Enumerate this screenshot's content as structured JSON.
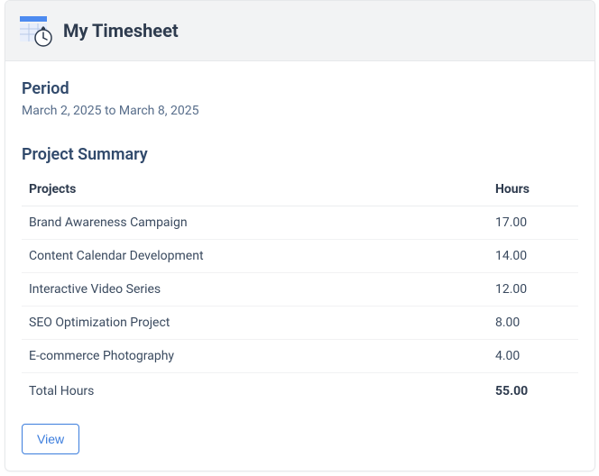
{
  "header": {
    "title": "My Timesheet"
  },
  "period": {
    "label": "Period",
    "range": "March 2, 2025 to March 8, 2025"
  },
  "summary": {
    "title": "Project Summary",
    "columns": {
      "projects": "Projects",
      "hours": "Hours"
    },
    "rows": [
      {
        "project": "Brand Awareness Campaign",
        "hours": "17.00"
      },
      {
        "project": "Content Calendar Development",
        "hours": "14.00"
      },
      {
        "project": "Interactive Video Series",
        "hours": "12.00"
      },
      {
        "project": "SEO Optimization Project",
        "hours": "8.00"
      },
      {
        "project": "E-commerce Photography",
        "hours": "4.00"
      }
    ],
    "total": {
      "label": "Total Hours",
      "value": "55.00"
    }
  },
  "actions": {
    "view": "View"
  },
  "colors": {
    "accent": "#3b7ddd",
    "heading": "#30496b"
  }
}
